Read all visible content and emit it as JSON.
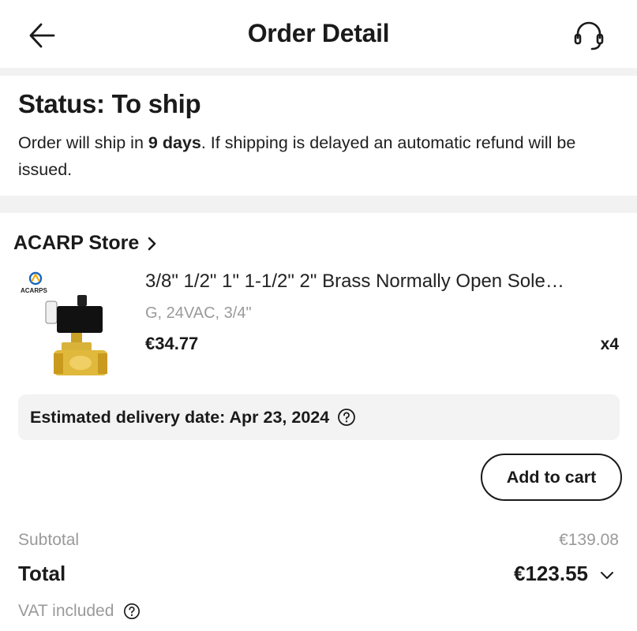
{
  "header": {
    "title": "Order Detail",
    "back_icon": "arrow-left-icon",
    "support_icon": "headset-icon"
  },
  "status": {
    "title": "Status: To ship",
    "message_prefix": "Order will ship in ",
    "message_days": "9 days",
    "message_suffix": ". If shipping is delayed an automatic refund will be issued."
  },
  "store": {
    "name": "ACARP Store",
    "chevron_icon": "chevron-right-icon"
  },
  "product": {
    "thumbnail_brand": "ACARPS",
    "name": "3/8\" 1/2\" 1\" 1-1/2\" 2\" Brass Normally Open Sole…",
    "variant": "G, 24VAC, 3/4\"",
    "price": "€34.77",
    "quantity": "x4"
  },
  "delivery": {
    "label": "Estimated delivery date: Apr 23, 2024",
    "help_icon": "question-circle-icon"
  },
  "actions": {
    "add_to_cart": "Add to cart"
  },
  "summary": {
    "subtotal_label": "Subtotal",
    "subtotal_value": "€139.08",
    "total_label": "Total",
    "total_value": "€123.55",
    "vat_label": "VAT included"
  },
  "colors": {
    "text": "#1a1a1a",
    "muted": "#9a9a9a",
    "separator": "#f2f2f2",
    "delivery_bg": "#f3f3f3"
  }
}
